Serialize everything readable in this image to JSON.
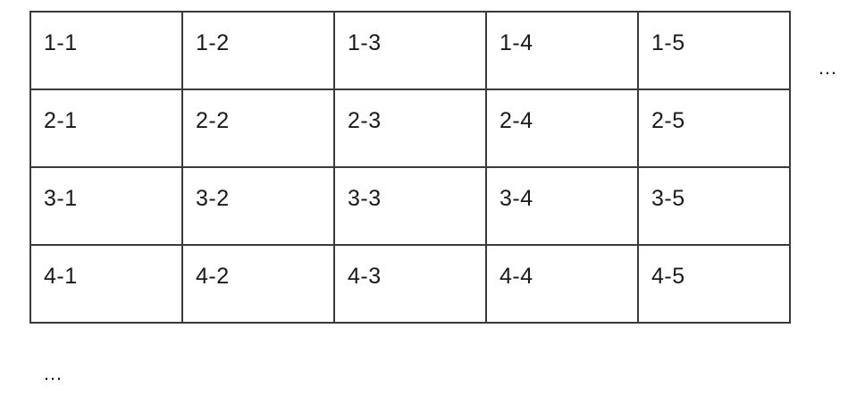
{
  "table": {
    "rows": [
      [
        "1-1",
        "1-2",
        "1-3",
        "1-4",
        "1-5"
      ],
      [
        "2-1",
        "2-2",
        "2-3",
        "2-4",
        "2-5"
      ],
      [
        "3-1",
        "3-2",
        "3-3",
        "3-4",
        "3-5"
      ],
      [
        "4-1",
        "4-2",
        "4-3",
        "4-4",
        "4-5"
      ]
    ]
  },
  "ellipsis_right": "…",
  "ellipsis_bottom": "…"
}
